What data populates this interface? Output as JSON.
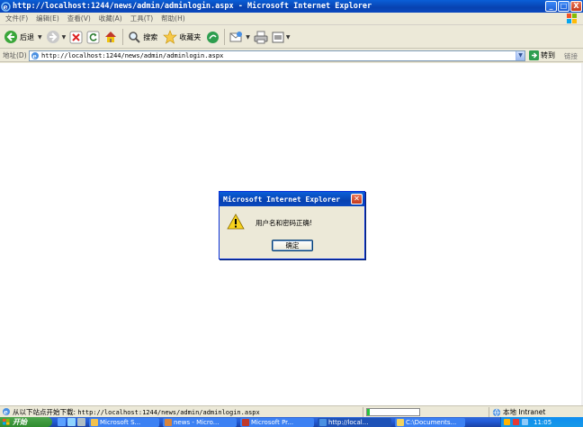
{
  "window": {
    "title": "http://localhost:1244/news/admin/adminlogin.aspx - Microsoft Internet Explorer",
    "buttons": [
      "_",
      "□",
      "X"
    ]
  },
  "menu": {
    "items": [
      "文件(F)",
      "编辑(E)",
      "查看(V)",
      "收藏(A)",
      "工具(T)",
      "帮助(H)"
    ]
  },
  "toolbar": {
    "back_label": "后退",
    "search_label": "搜索",
    "favorites_label": "收藏夹"
  },
  "address": {
    "label": "地址(D)",
    "url": "http://localhost:1244/news/admin/adminlogin.aspx",
    "go_label": "转到",
    "links_label": "链接"
  },
  "dialog": {
    "title": "Microsoft Internet Explorer",
    "message": "用户名和密码正确!",
    "ok_label": "确定"
  },
  "status": {
    "message_prefix": "从以下站点开始下载:",
    "message_url": "http://localhost:1244/news/admin/adminlogin.aspx",
    "zone": "本地 Intranet",
    "progress": 0.05
  },
  "taskbar": {
    "start_label": "开始",
    "tasks": [
      {
        "label": "Microsoft S...",
        "color": "#f2c14e"
      },
      {
        "label": "news - Micro...",
        "color": "#d9843b"
      },
      {
        "label": "Microsoft Pr...",
        "color": "#c0392b"
      },
      {
        "label": "http://local...",
        "color": "#4a90e2"
      },
      {
        "label": "C:\\Documents...",
        "color": "#f4d35e"
      }
    ],
    "clock": "11:05"
  },
  "colors": {
    "titlebar": "#0a5fd8",
    "taskbar": "#245edb",
    "start": "#2e8b2e",
    "progress": "#26c43b"
  }
}
